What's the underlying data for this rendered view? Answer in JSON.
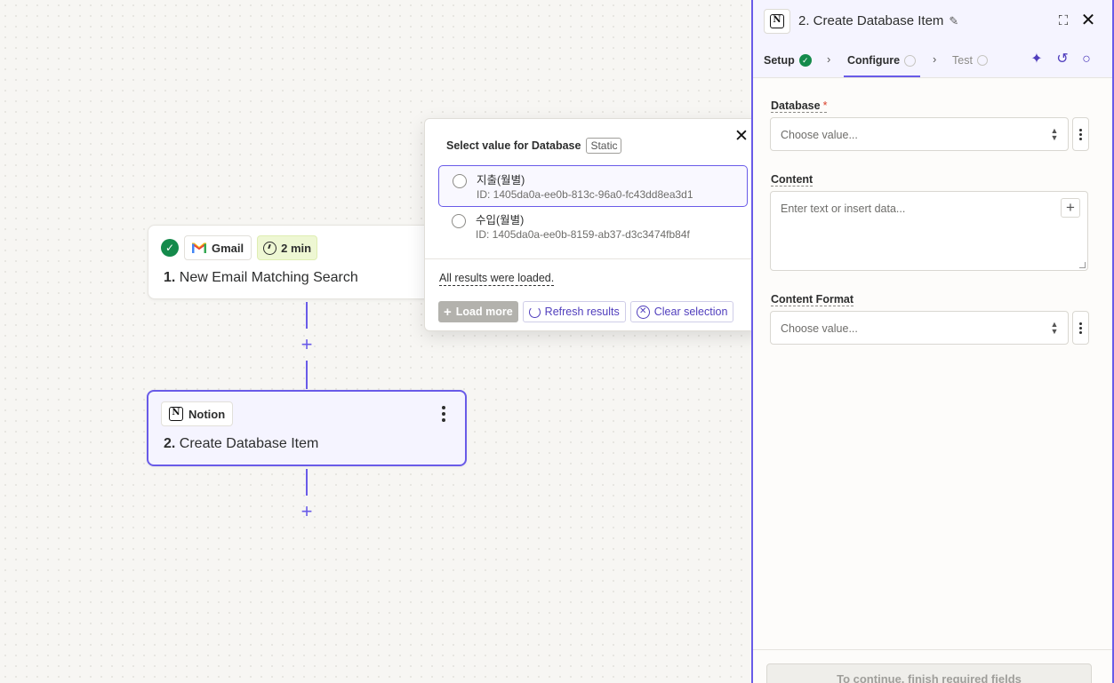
{
  "canvas": {
    "step1": {
      "status": "complete",
      "app_name": "Gmail",
      "duration": "2 min",
      "number": "1.",
      "title": "New Email Matching Search"
    },
    "step2": {
      "app_name": "Notion",
      "number": "2.",
      "title": "Create Database Item"
    }
  },
  "popover": {
    "title": "Select value for Database",
    "badge": "Static",
    "options": [
      {
        "label": "지출(월별)",
        "id": "ID: 1405da0a-ee0b-813c-96a0-fc43dd8ea3d1",
        "selected": true
      },
      {
        "label": "수입(월별)",
        "id": "ID: 1405da0a-ee0b-8159-ab37-d3c3474fb84f",
        "selected": false
      }
    ],
    "status": "All results were loaded.",
    "load_more": "Load more",
    "refresh": "Refresh results",
    "clear": "Clear selection"
  },
  "panel": {
    "title": "2. Create Database Item",
    "tabs": {
      "setup": "Setup",
      "configure": "Configure",
      "test": "Test"
    },
    "fields": {
      "database_label": "Database",
      "database_required": "*",
      "database_placeholder": "Choose value...",
      "content_label": "Content",
      "content_placeholder": "Enter text or insert data...",
      "format_label": "Content Format",
      "format_placeholder": "Choose value..."
    },
    "continue_label": "To continue, finish required fields"
  },
  "colors": {
    "accent": "#695be8",
    "success": "#148a4b",
    "required": "#d9412a"
  }
}
